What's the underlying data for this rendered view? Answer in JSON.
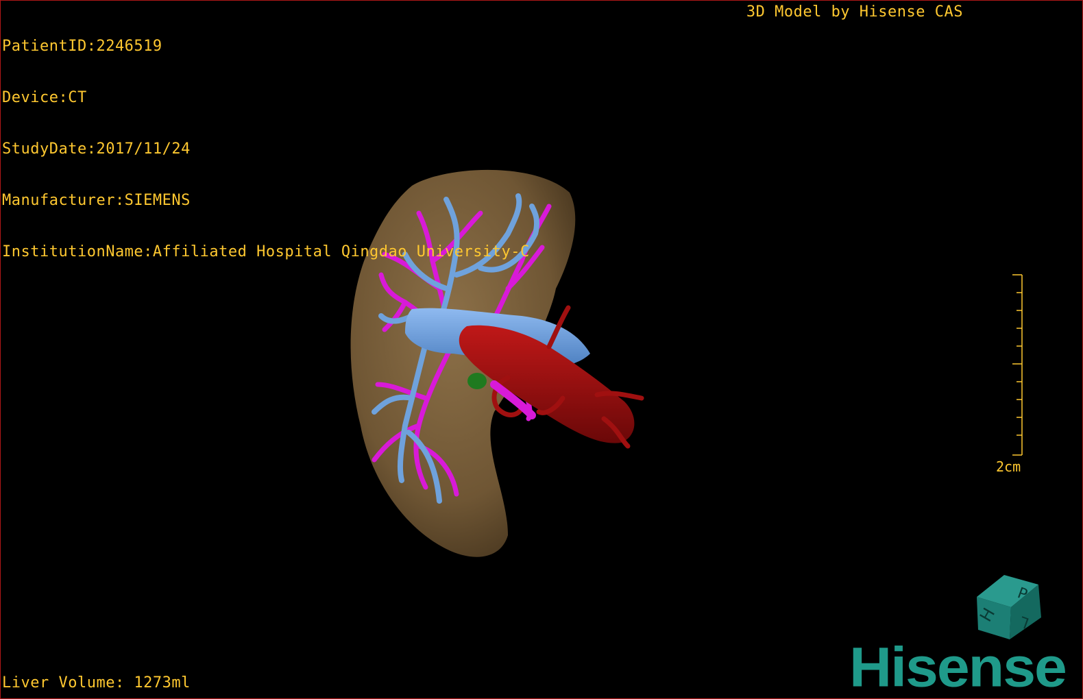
{
  "header": {
    "patient_id": "PatientID:2246519",
    "device": "Device:CT",
    "study_date": "StudyDate:2017/11/24",
    "manufacturer": "Manufacturer:SIEMENS",
    "institution": "InstitutionName:Affiliated Hospital Qingdao University-C"
  },
  "brand_title": "3D Model by Hisense CAS",
  "liver_volume": "Liver Volume: 1273ml",
  "scale": {
    "label": "2cm"
  },
  "orientation_cube": {
    "labels": [
      "H",
      "P",
      "L"
    ]
  },
  "logo": {
    "text": "Hisense"
  },
  "colors": {
    "overlay_text": "#ffc830",
    "liver": "#7a6038",
    "portal_vein": "#6fa2dc",
    "hepatic_artery": "#d81ad8",
    "aorta": "#a01010",
    "gallbladder": "#1f7a1f",
    "brand": "#1f9a8a",
    "border": "#b01818"
  }
}
